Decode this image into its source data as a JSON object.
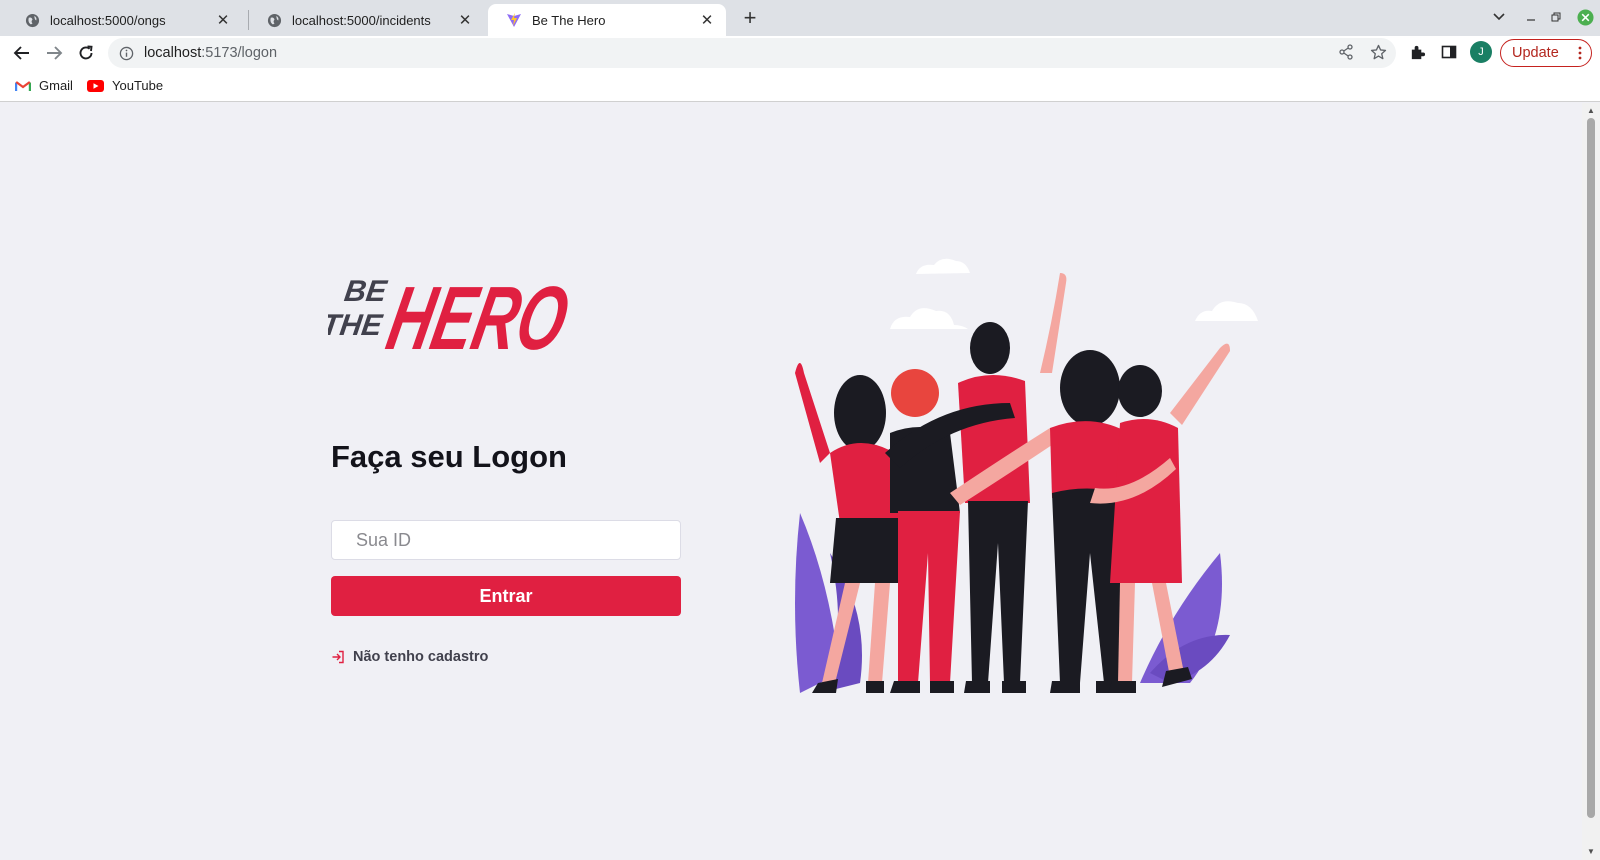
{
  "browser": {
    "tabs": [
      {
        "title": "localhost:5000/ongs",
        "icon": "globe-icon",
        "active": false
      },
      {
        "title": "localhost:5000/incidents",
        "icon": "globe-icon",
        "active": false
      },
      {
        "title": "Be The Hero",
        "icon": "vite-icon",
        "active": true
      }
    ],
    "new_tab_label": "+",
    "url": {
      "host": "localhost",
      "rest": ":5173/logon"
    },
    "profile_initial": "J",
    "update_label": "Update",
    "bookmarks": [
      {
        "label": "Gmail",
        "icon": "gmail-icon"
      },
      {
        "label": "YouTube",
        "icon": "youtube-icon"
      }
    ]
  },
  "logon": {
    "logo": {
      "line1": "BE",
      "line2": "THE",
      "big": "HERO"
    },
    "title": "Faça seu Logon",
    "id_placeholder": "Sua ID",
    "id_value": "",
    "submit_label": "Entrar",
    "register_link": "Não tenho cadastro"
  },
  "colors": {
    "brand_red": "#E02041",
    "text_dark": "#13131A",
    "background": "#F0F0F5",
    "plant_purple": "#7B5BD1",
    "update_red": "#B3261E"
  }
}
